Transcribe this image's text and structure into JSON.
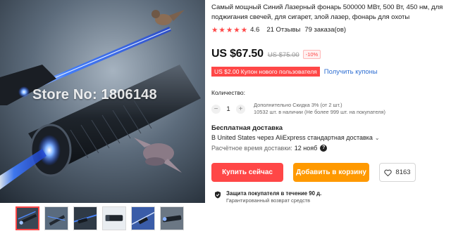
{
  "gallery": {
    "watermark": "Store No: 1806148",
    "thumbnails": [
      "thumb-1",
      "thumb-2",
      "thumb-3",
      "thumb-4",
      "thumb-5",
      "thumb-6"
    ],
    "active_index": 0
  },
  "product": {
    "title": "Самый мощный Синий Лазерный фонарь 500000 МВт, 500 Вт, 450 нм, для поджигания свечей, для сигарет, злой лазер, фонарь для охоты",
    "rating": "4.6",
    "rating_value": 4.6,
    "reviews": "21 Отзывы",
    "orders": "79 заказа(ов)"
  },
  "price": {
    "current": "US $67.50",
    "original": "US $75.00",
    "discount": "-10%"
  },
  "coupon": {
    "label": "US $2.00 Купон нового пользователя",
    "link": "Получить купоны"
  },
  "quantity": {
    "label": "Количество:",
    "value": "1",
    "minus": "−",
    "plus": "+",
    "note_discount": "Дополнительно Скидка 3% (от 2 шт.)",
    "note_stock": "10532 шт. в наличии (Не более 999 шт. на покупателя)"
  },
  "shipping": {
    "title": "Бесплатная доставка",
    "method": "В United States через AliExpress стандартная доставка",
    "chevron": "⌄",
    "eta_label": "Расчётное время доставки:",
    "eta_date": "12 нояб",
    "help": "?"
  },
  "actions": {
    "buy_now": "Купить сейчас",
    "add_to_cart": "Добавить в корзину",
    "wishlist_count": "8163"
  },
  "protection": {
    "title": "Защита покупателя в течение 90 д.",
    "subtitle": "Гарантированный возврат средств"
  },
  "colors": {
    "accent_red": "#ff4747",
    "accent_orange": "#ff9900",
    "link_blue": "#2e6ed2"
  }
}
